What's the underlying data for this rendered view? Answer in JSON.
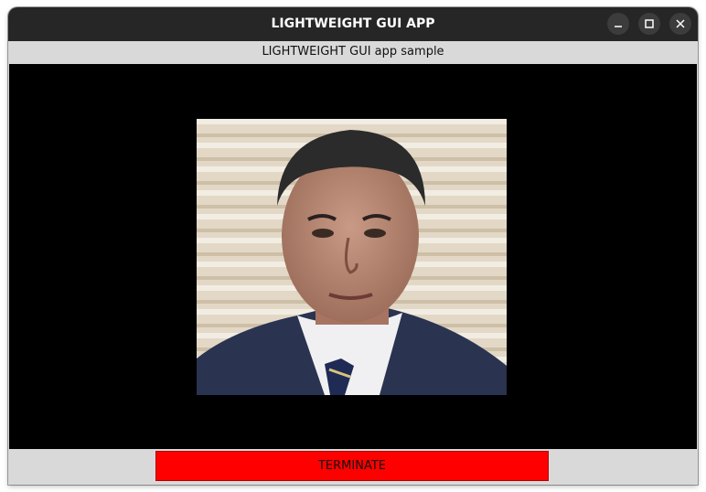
{
  "window": {
    "title": "LIGHTWEIGHT GUI APP",
    "controls": {
      "minimize_icon": "minimize-icon",
      "maximize_icon": "maximize-icon",
      "close_icon": "close-icon"
    }
  },
  "header": {
    "subtitle": "LIGHTWEIGHT GUI app sample"
  },
  "main": {
    "image_icon": "portrait-photo",
    "background_color": "#000000"
  },
  "footer": {
    "terminate_label": "TERMINATE",
    "terminate_color": "#ff0000"
  }
}
